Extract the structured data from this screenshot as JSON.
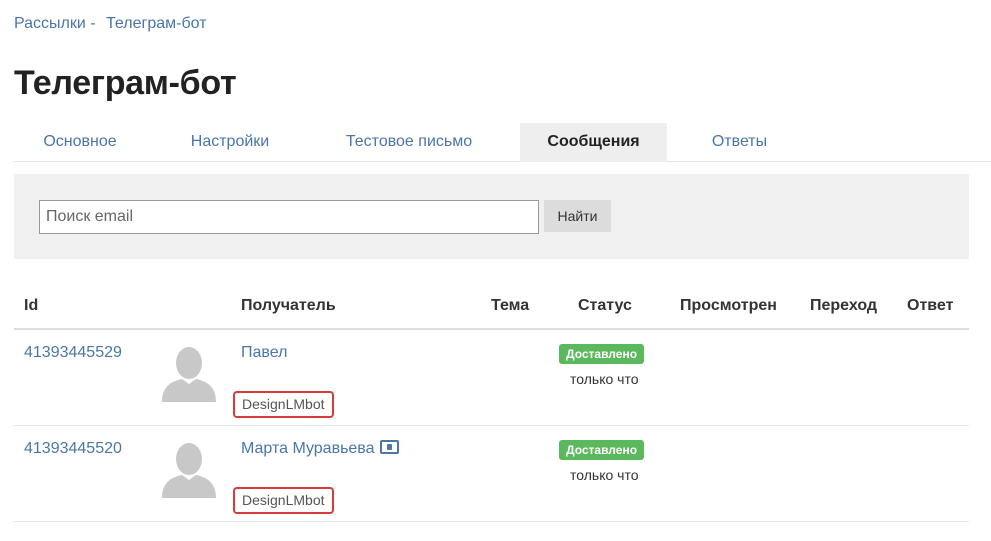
{
  "breadcrumb": {
    "parent": "Рассылки",
    "separator": "-",
    "current": "Телеграм-бот"
  },
  "page_title": "Телеграм-бот",
  "tabs": [
    {
      "label": "Основное"
    },
    {
      "label": "Настройки"
    },
    {
      "label": "Тестовое письмо"
    },
    {
      "label": "Сообщения"
    },
    {
      "label": "Ответы"
    }
  ],
  "search": {
    "placeholder": "Поиск email",
    "value": "",
    "button_label": "Найти"
  },
  "table": {
    "columns": [
      "Id",
      "Получатель",
      "Тема",
      "Статус",
      "Просмотрен",
      "Переход",
      "Ответ"
    ],
    "rows": [
      {
        "id": "41393445529",
        "recipient": "Павел",
        "has_id_card_icon": false,
        "bot": "DesignLMbot",
        "status": "Доставлено",
        "time": "только что"
      },
      {
        "id": "41393445520",
        "recipient": "Марта Муравьева",
        "has_id_card_icon": true,
        "bot": "DesignLMbot",
        "status": "Доставлено",
        "time": "только что"
      }
    ]
  },
  "colors": {
    "link": "#4a76a8",
    "status_delivered": "#5cb85c",
    "highlight_border": "#d63c3c",
    "active_tab_bg": "#eeeeee",
    "panel_bg": "#f0f0f0"
  },
  "icons": {
    "avatar": "default-user-silhouette-icon",
    "recipient_badge": "id-card-icon"
  }
}
